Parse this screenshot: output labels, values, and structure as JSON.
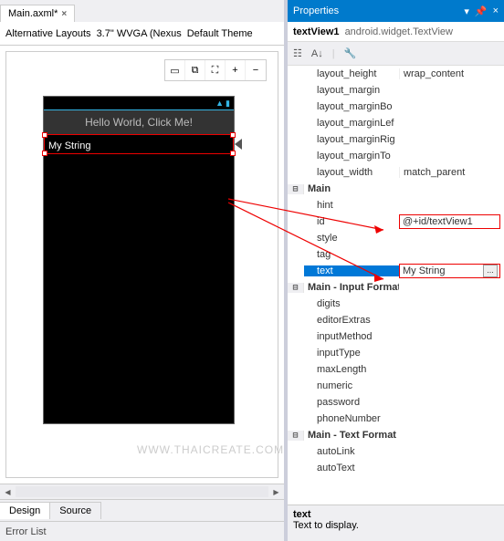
{
  "tabs": {
    "file": "Main.axml*"
  },
  "toolbar": {
    "alt_layouts": "Alternative Layouts",
    "device": "3.7\" WVGA (Nexus",
    "theme": "Default Theme"
  },
  "preview": {
    "hello": "Hello World, Click Me!",
    "selected_text": "My String"
  },
  "bottom_tabs": {
    "design": "Design",
    "source": "Source"
  },
  "error_list": "Error List",
  "watermark": "WWW.THAICREATE.COM",
  "props": {
    "title": "Properties",
    "object_name": "textView1",
    "object_type": "android.widget.TextView",
    "rows": {
      "layout_height": {
        "k": "layout_height",
        "v": "wrap_content"
      },
      "layout_margin": {
        "k": "layout_margin",
        "v": ""
      },
      "layout_marginBo": {
        "k": "layout_marginBo",
        "v": ""
      },
      "layout_marginLe": {
        "k": "layout_marginLef",
        "v": ""
      },
      "layout_marginRi": {
        "k": "layout_marginRig",
        "v": ""
      },
      "layout_marginTo": {
        "k": "layout_marginTo",
        "v": ""
      },
      "layout_width": {
        "k": "layout_width",
        "v": "match_parent"
      },
      "main": {
        "k": "Main"
      },
      "hint": {
        "k": "hint",
        "v": ""
      },
      "id": {
        "k": "id",
        "v": "@+id/textView1"
      },
      "style": {
        "k": "style",
        "v": ""
      },
      "tag": {
        "k": "tag",
        "v": ""
      },
      "text": {
        "k": "text",
        "v": "My String"
      },
      "main_input": {
        "k": "Main - Input Format"
      },
      "digits": {
        "k": "digits",
        "v": ""
      },
      "editorExtras": {
        "k": "editorExtras",
        "v": ""
      },
      "inputMethod": {
        "k": "inputMethod",
        "v": ""
      },
      "inputType": {
        "k": "inputType",
        "v": ""
      },
      "maxLength": {
        "k": "maxLength",
        "v": ""
      },
      "numeric": {
        "k": "numeric",
        "v": ""
      },
      "password": {
        "k": "password",
        "v": ""
      },
      "phoneNumber": {
        "k": "phoneNumber",
        "v": ""
      },
      "main_text": {
        "k": "Main - Text Format"
      },
      "autoLink": {
        "k": "autoLink",
        "v": ""
      },
      "autoText": {
        "k": "autoText",
        "v": ""
      }
    },
    "desc_name": "text",
    "desc_text": "Text to display.",
    "ellipsis": "..."
  }
}
